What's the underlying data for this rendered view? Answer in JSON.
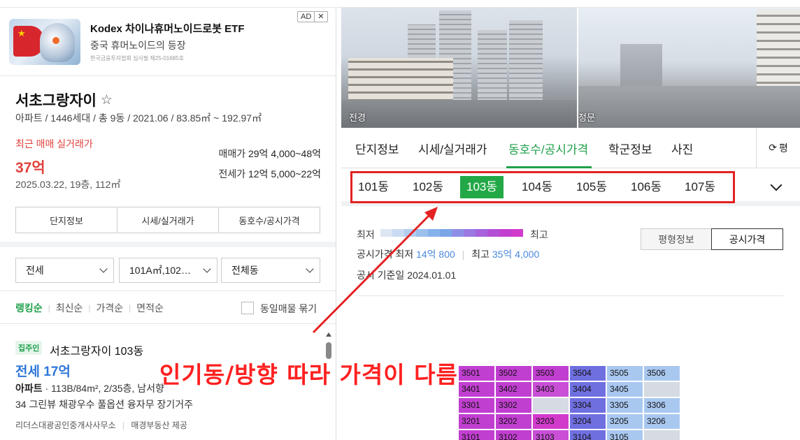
{
  "ad": {
    "title": "Kodex 차이나휴머노이드로봇 ETF",
    "subtitle": "중국 휴머노이드의 등장",
    "note": "한국금융투자협회 심사필 제25-01685호",
    "badge": "AD",
    "close": "✕"
  },
  "complex": {
    "name": "서초그랑자이",
    "meta": "아파트 / 1446세대 / 총 9동 / 2021.06 / 83.85㎡ ~ 192.97㎡",
    "recent_label": "최근 매매 실거래가",
    "recent_price": "37억",
    "recent_date": "2025.03.22, 19층, 112㎡",
    "sale_label": "매매가",
    "sale_range": "29억 4,000~48억",
    "jeonse_label": "전세가",
    "jeonse_range": "12억 5,000~22억",
    "tabs": [
      "단지정보",
      "시세/실거래가",
      "동호수/공시가격"
    ]
  },
  "filters": {
    "trade_type": "전세",
    "area": "101A㎡,102…",
    "dong": "전체동"
  },
  "sort": {
    "options": [
      "랭킹순",
      "최신순",
      "가격순",
      "면적순"
    ],
    "active": "랭킹순",
    "checkbox_label": "동일매물 묶기"
  },
  "listing": {
    "badge": "집주인",
    "title": "서초그랑자이 103동",
    "price": "전세 17억",
    "type": "아파트",
    "desc": "· 113B/84m², 2/35층, 남서향",
    "tags": "34 그린뷰 채광우수 풀옵션 융자무 장기거주",
    "agency": "리더스대광공인중개사사무소",
    "provider": "매경부동산 제공"
  },
  "photos": [
    {
      "label": "전경"
    },
    {
      "label": "정문"
    }
  ],
  "right_tabs": {
    "items": [
      "단지정보",
      "시세/실거래가",
      "동호수/공시가격",
      "학군정보",
      "사진"
    ],
    "active": "동호수/공시가격",
    "refresh_label": "평"
  },
  "dongs": {
    "items": [
      "101동",
      "102동",
      "103동",
      "104동",
      "105동",
      "106동",
      "107동"
    ],
    "active": "103동"
  },
  "legend": {
    "low": "최저",
    "high": "최고",
    "colors": [
      "#dde6f3",
      "#c9dbf2",
      "#b3cdf0",
      "#9cc0ee",
      "#86b2eb",
      "#7aa6e8",
      "#8d8fe6",
      "#9b78e2",
      "#a762dc",
      "#b34fd6",
      "#c23fd0",
      "#d23acc"
    ],
    "price_label": "공시가격",
    "min_label": "최저",
    "min_value": "14억 800",
    "max_label": "최고",
    "max_value": "35억 4,000",
    "date_label": "공시 기준일",
    "date_value": "2024.01.01",
    "toggle_area": "평형정보",
    "toggle_price": "공시가격"
  },
  "units": {
    "rows": [
      [
        "3501",
        "3502",
        "3503",
        "3504",
        "3505",
        "3506"
      ],
      [
        "3401",
        "3402",
        "3403",
        "3404",
        "3405",
        ""
      ],
      [
        "3301",
        "3302",
        "",
        "3304",
        "3305",
        "3306"
      ],
      [
        "3201",
        "3202",
        "3203",
        "3204",
        "3205",
        "3206"
      ],
      [
        "3101",
        "3102",
        "3103",
        "3104",
        "3105",
        ""
      ]
    ],
    "colors": [
      [
        "#c13fd0",
        "#c13fd0",
        "#c13fd0",
        "#6f6fe0",
        "#a9c8f0",
        "#a9c8f0"
      ],
      [
        "#c13fd0",
        "#c13fd0",
        "#c84fd6",
        "#6f6fe0",
        "#a9c8f0",
        ""
      ],
      [
        "#c13fd0",
        "#c13fd0",
        "",
        "#6f6fe0",
        "#a9c8f0",
        "#a9c8f0"
      ],
      [
        "#c13fd0",
        "#c13fd0",
        "#d23acc",
        "#6f6fe0",
        "#a9c8f0",
        "#a9c8f0"
      ],
      [
        "#c13fd0",
        "#c13fd0",
        "#c84fd6",
        "#6f6fe0",
        "#a9c8f0",
        ""
      ]
    ]
  },
  "annotation": {
    "text": "인기동/방향 따라 가격이 다름",
    "color": "#ff2020"
  }
}
